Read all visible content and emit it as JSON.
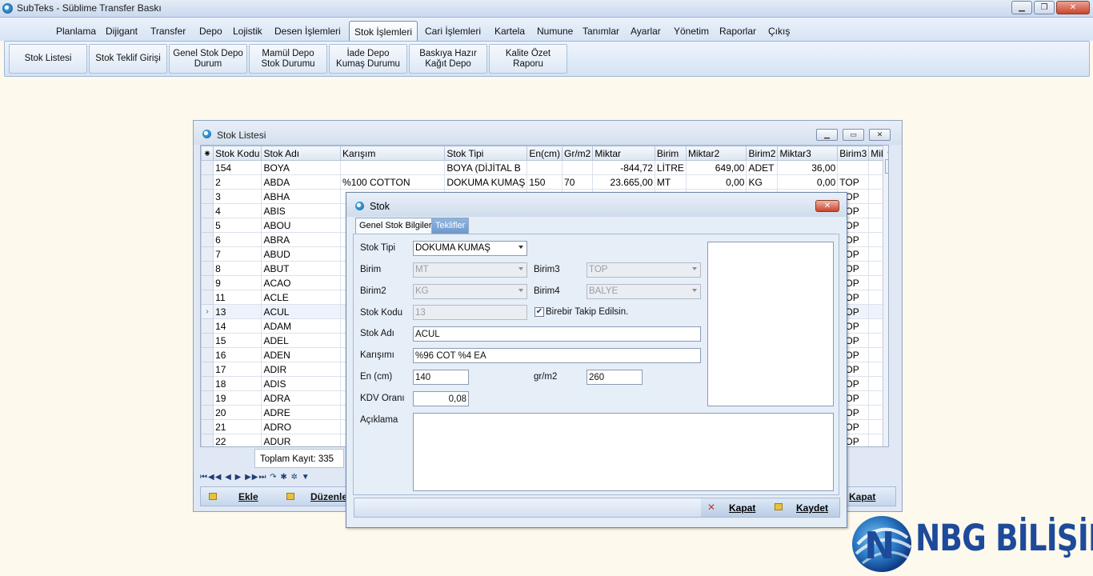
{
  "app": {
    "title": "SubTeks - Süblime Transfer Baskı"
  },
  "menu": [
    "Planlama",
    "Dijigant",
    "Transfer",
    "Depo",
    "Lojistik",
    "Desen İşlemleri",
    "Stok İşlemleri",
    "Cari İşlemleri",
    "Kartela",
    "Numune",
    "Tanımlar",
    "Ayarlar",
    "Yönetim",
    "Raporlar",
    "Çıkış"
  ],
  "menu_active": "Stok İşlemleri",
  "ribbon": [
    "Stok Listesi",
    "Stok Teklif Girişi",
    "Genel Stok Depo Durum",
    "Mamül Depo Stok Durumu",
    "İade Depo Kumaş Durumu",
    "Baskıya Hazır Kağıt Depo",
    "Kalite Özet Raporu"
  ],
  "list_window": {
    "title": "Stok Listesi",
    "columns": [
      "Stok Kodu",
      "Stok Adı",
      "Karışım",
      "Stok Tipi",
      "En(cm)",
      "Gr/m2",
      "Miktar",
      "Birim",
      "Miktar2",
      "Birim2",
      "Miktar3",
      "Birim3",
      "Mik"
    ],
    "rows": [
      [
        "154",
        "BOYA",
        "",
        "BOYA (DİJİTAL B",
        "",
        "",
        "-844,72",
        "LİTRE",
        "649,00",
        "ADET",
        "36,00",
        ""
      ],
      [
        "2",
        "ABDA",
        "%100 COTTON",
        "DOKUMA KUMAŞ",
        "150",
        "70",
        "23.665,00",
        "MT",
        "0,00",
        "KG",
        "0,00",
        "TOP"
      ],
      [
        "3",
        "ABHA",
        "",
        "",
        "",
        "",
        "",
        "",
        "",
        "",
        "",
        "TOP"
      ],
      [
        "4",
        "ABIS",
        "",
        "",
        "",
        "",
        "",
        "",
        "",
        "",
        "",
        "TOP"
      ],
      [
        "5",
        "ABOU",
        "",
        "",
        "",
        "",
        "",
        "",
        "",
        "",
        "",
        "TOP"
      ],
      [
        "6",
        "ABRA",
        "",
        "",
        "",
        "",
        "",
        "",
        "",
        "",
        "",
        "TOP"
      ],
      [
        "7",
        "ABUD",
        "",
        "",
        "",
        "",
        "",
        "",
        "",
        "",
        "",
        "TOP"
      ],
      [
        "8",
        "ABUT",
        "",
        "",
        "",
        "",
        "",
        "",
        "",
        "",
        "",
        "TOP"
      ],
      [
        "9",
        "ACAO",
        "",
        "",
        "",
        "",
        "",
        "",
        "",
        "",
        "",
        "TOP"
      ],
      [
        "11",
        "ACLE",
        "",
        "",
        "",
        "",
        "",
        "",
        "",
        "",
        "",
        "TOP"
      ],
      [
        "13",
        "ACUL",
        "",
        "",
        "",
        "",
        "",
        "",
        "",
        "",
        "",
        "TOP"
      ],
      [
        "14",
        "ADAM",
        "",
        "",
        "",
        "",
        "",
        "",
        "",
        "",
        "",
        "TOP"
      ],
      [
        "15",
        "ADEL",
        "",
        "",
        "",
        "",
        "",
        "",
        "",
        "",
        "",
        "TOP"
      ],
      [
        "16",
        "ADEN",
        "",
        "",
        "",
        "",
        "",
        "",
        "",
        "",
        "",
        "TOP"
      ],
      [
        "17",
        "ADIR",
        "",
        "",
        "",
        "",
        "",
        "",
        "",
        "",
        "",
        "TOP"
      ],
      [
        "18",
        "ADIS",
        "",
        "",
        "",
        "",
        "",
        "",
        "",
        "",
        "",
        "TOP"
      ],
      [
        "19",
        "ADRA",
        "",
        "",
        "",
        "",
        "",
        "",
        "",
        "",
        "",
        "TOP"
      ],
      [
        "20",
        "ADRE",
        "",
        "",
        "",
        "",
        "",
        "",
        "",
        "",
        "",
        "TOP"
      ],
      [
        "21",
        "ADRO",
        "",
        "",
        "",
        "",
        "",
        "",
        "",
        "",
        "",
        "TOP"
      ],
      [
        "22",
        "ADUR",
        "",
        "",
        "",
        "",
        "",
        "",
        "",
        "",
        "",
        "TOP"
      ]
    ],
    "total_label": "Toplam Kayıt: 335",
    "nav_glyphs": "⏮◀◀ ◀ ▶ ▶▶⏭ ↷ ✱ ✲ ▼",
    "buttons": {
      "add": "Ekle",
      "edit": "Düzenle",
      "close": "Kapat"
    }
  },
  "dialog": {
    "title": "Stok",
    "tabs": [
      "Genel Stok Bilgileri",
      "Teklifler"
    ],
    "labels": {
      "stok_tipi": "Stok Tipi",
      "birim": "Birim",
      "birim3": "Birim3",
      "birim2": "Birim2",
      "birim4": "Birim4",
      "stok_kodu": "Stok Kodu",
      "birebir": "Birebir Takip Edilsin.",
      "stok_adi": "Stok Adı",
      "karisimi": "Karışımı",
      "en": "En (cm)",
      "grm2": "gr/m2",
      "kdv": "KDV Oranı",
      "aciklama": "Açıklama"
    },
    "values": {
      "stok_tipi": "DOKUMA KUMAŞ",
      "birim": "MT",
      "birim3": "TOP",
      "birim2": "KG",
      "birim4": "BALYE",
      "stok_kodu": "13",
      "stok_adi": "ACUL",
      "karisimi": "%96 COT %4 EA",
      "en": "140",
      "grm2": "260",
      "kdv": "0,08"
    },
    "buttons": {
      "close": "Kapat",
      "save": "Kaydet"
    }
  },
  "logo": {
    "text": "NBG BİLİŞİM"
  },
  "colors": {
    "accent": "#1d4a9a",
    "desktop": "#fdf9ec"
  }
}
